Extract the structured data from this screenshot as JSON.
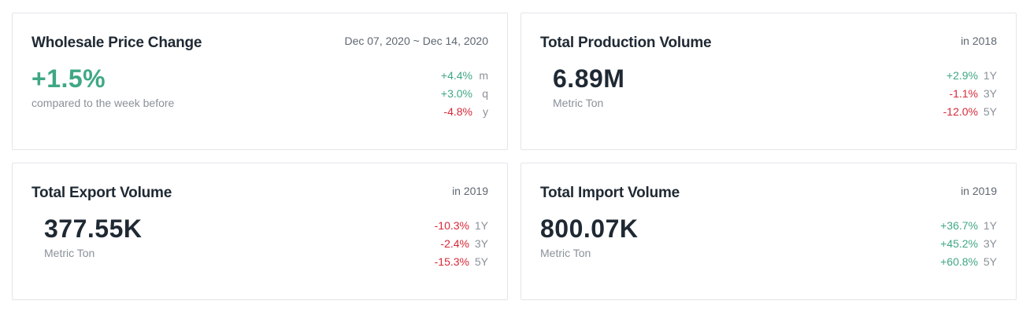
{
  "cards": [
    {
      "title": "Wholesale Price Change",
      "meta": "Dec 07, 2020 ~ Dec 14, 2020",
      "value": "+1.5%",
      "sublabel": "compared to the week before",
      "changes": [
        {
          "value": "+4.4%",
          "period": "m",
          "trend": "up"
        },
        {
          "value": "+3.0%",
          "period": "q",
          "trend": "up"
        },
        {
          "value": "-4.8%",
          "period": "y",
          "trend": "down"
        }
      ]
    },
    {
      "title": "Total Production Volume",
      "meta": "in 2018",
      "value": "6.89M",
      "sublabel": "Metric Ton",
      "changes": [
        {
          "value": "+2.9%",
          "period": "1Y",
          "trend": "up"
        },
        {
          "value": "-1.1%",
          "period": "3Y",
          "trend": "down"
        },
        {
          "value": "-12.0%",
          "period": "5Y",
          "trend": "down"
        }
      ]
    },
    {
      "title": "Total Export Volume",
      "meta": "in 2019",
      "value": "377.55K",
      "sublabel": "Metric Ton",
      "changes": [
        {
          "value": "-10.3%",
          "period": "1Y",
          "trend": "down"
        },
        {
          "value": "-2.4%",
          "period": "3Y",
          "trend": "down"
        },
        {
          "value": "-15.3%",
          "period": "5Y",
          "trend": "down"
        }
      ]
    },
    {
      "title": "Total Import Volume",
      "meta": "in 2019",
      "value": "800.07K",
      "sublabel": "Metric Ton",
      "changes": [
        {
          "value": "+36.7%",
          "period": "1Y",
          "trend": "up"
        },
        {
          "value": "+45.2%",
          "period": "3Y",
          "trend": "up"
        },
        {
          "value": "+60.8%",
          "period": "5Y",
          "trend": "up"
        }
      ]
    }
  ],
  "colors": {
    "positive": "#3fa883",
    "negative": "#d62839",
    "muted": "#8a9199",
    "border": "#e3e5e8",
    "text": "#1f2933"
  }
}
